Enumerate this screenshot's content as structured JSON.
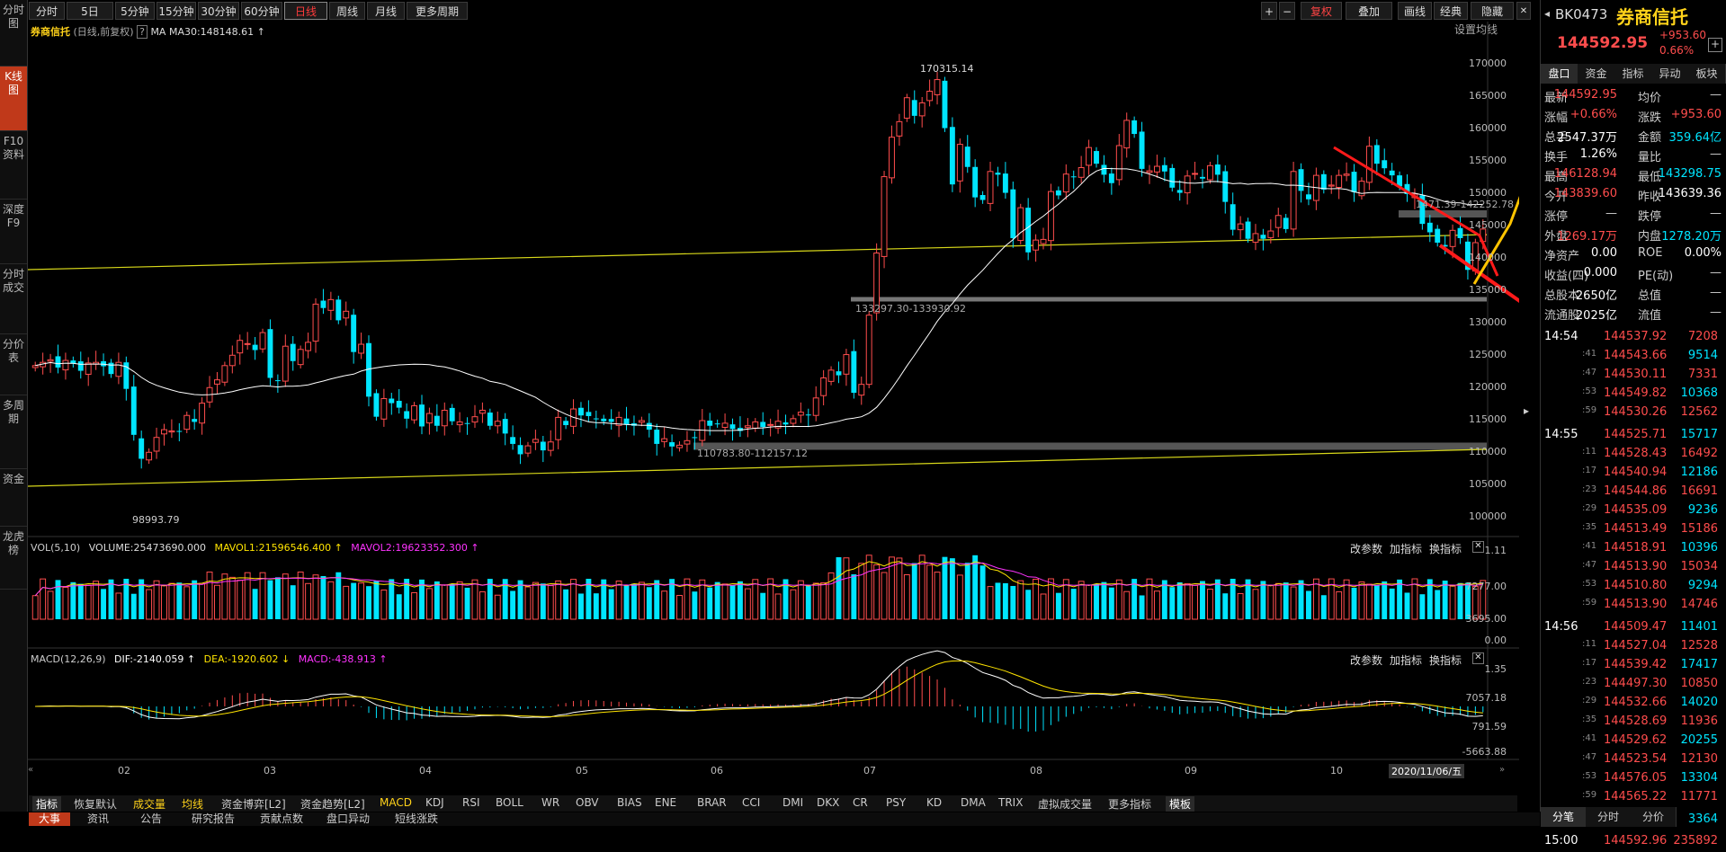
{
  "left_nav": [
    "分时图",
    "K线图",
    "F10资料",
    "深度F9",
    "分时成交",
    "分价表",
    "多周期",
    "资金",
    "龙虎榜"
  ],
  "toolbar": {
    "tabs": [
      "分时",
      "5日",
      "5分钟",
      "15分钟",
      "30分钟",
      "60分钟",
      "日线",
      "周线",
      "月线",
      "更多周期"
    ],
    "active_tab": "日线",
    "right_buttons": [
      "+",
      "−",
      "复权",
      "叠加",
      "画线",
      "经典",
      "隐藏"
    ]
  },
  "main_header": {
    "name": "券商信托",
    "mode": "(日线,前复权)",
    "ma": "MA",
    "ma30": "MA30:148148.61 ↑",
    "setting": "设置均线"
  },
  "price_axis": [
    "170000",
    "165000",
    "160000",
    "155000",
    "150000",
    "145000",
    "140000",
    "135000",
    "130000",
    "125000",
    "120000",
    "115000",
    "110000",
    "105000",
    "100000"
  ],
  "annotations": {
    "high": "170315.14",
    "low": "98993.79",
    "gap1": "133297.30-133930.92",
    "gap2": "110783.80-112157.12",
    "gap3": "1471.39-142252.78"
  },
  "volume": {
    "name": "VOL(5,10)",
    "volume": "VOLUME:25473690.000",
    "mavol1": "MAVOL1:21596546.400 ↑",
    "mavol2": "MAVOL2:19623352.300 ↑",
    "axis": [
      "1.11",
      "7277.00",
      "3695.00",
      "0.00"
    ],
    "actions": [
      "改参数",
      "加指标",
      "换指标"
    ]
  },
  "macd": {
    "name": "MACD(12,26,9)",
    "dif": "DIF:-2140.059 ↑",
    "dea": "DEA:-1920.602 ↓",
    "macd": "MACD:-438.913 ↑",
    "axis": [
      "1.35",
      "7057.18",
      "791.59",
      "-5663.88"
    ],
    "actions": [
      "改参数",
      "加指标",
      "换指标"
    ]
  },
  "date_axis": [
    "02",
    "03",
    "04",
    "05",
    "06",
    "07",
    "08",
    "09",
    "10"
  ],
  "date_label": "2020/11/06/五",
  "indicator_bar": [
    "指标",
    "恢复默认",
    "成交量",
    "均线",
    "资金博弈[L2]",
    "资金趋势[L2]",
    "MACD",
    "KDJ",
    "RSI",
    "BOLL",
    "WR",
    "OBV",
    "BIAS",
    "ENE",
    "BRAR",
    "CCI",
    "DMI",
    "DKX",
    "CR",
    "PSY",
    "KD",
    "DMA",
    "TRIX",
    "虚拟成交量",
    "更多指标",
    "模板"
  ],
  "news_tabs": [
    "大事",
    "资讯",
    "公告",
    "研究报告",
    "贡献点数",
    "盘口异动",
    "短线涨跌"
  ],
  "quote": {
    "code": "BK0473",
    "name": "券商信托",
    "price": "144592.95",
    "change": "+953.60",
    "pct": "0.66%",
    "tabs": [
      "盘口",
      "资金",
      "指标",
      "异动",
      "板块"
    ],
    "rows": [
      [
        "最新",
        "144592.95",
        "均价",
        "—"
      ],
      [
        "涨幅",
        "+0.66%",
        "涨跌",
        "+953.60"
      ],
      [
        "总手",
        "2547.37万",
        "金额",
        "359.64亿"
      ],
      [
        "换手",
        "1.26%",
        "量比",
        "—"
      ],
      [
        "最高",
        "146128.94",
        "最低",
        "143298.75"
      ],
      [
        "今开",
        "143839.60",
        "昨收",
        "143639.36"
      ],
      [
        "涨停",
        "—",
        "跌停",
        "—"
      ],
      [
        "外盘",
        "1269.17万",
        "内盘",
        "1278.20万"
      ],
      [
        "净资产",
        "0.00",
        "ROE",
        "0.00%"
      ],
      [
        "收益(四)",
        "0.000",
        "PE(动)",
        "—"
      ],
      [
        "总股本",
        "2650亿",
        "总值",
        "—"
      ],
      [
        "流通股",
        "2025亿",
        "流值",
        "—"
      ]
    ],
    "bottom_tabs": [
      "分笔",
      "分时",
      "分价"
    ]
  },
  "ticks": [
    [
      "14:54",
      "144537.92",
      "7208"
    ],
    [
      ":41",
      "144543.66",
      "9514"
    ],
    [
      ":47",
      "144530.11",
      "7331"
    ],
    [
      ":53",
      "144549.82",
      "10368"
    ],
    [
      ":59",
      "144530.26",
      "12562"
    ],
    [
      "14:55",
      "144525.71",
      "15717"
    ],
    [
      ":11",
      "144528.43",
      "16492"
    ],
    [
      ":17",
      "144540.94",
      "12186"
    ],
    [
      ":23",
      "144544.86",
      "16691"
    ],
    [
      ":29",
      "144535.09",
      "9236"
    ],
    [
      ":35",
      "144513.49",
      "15186"
    ],
    [
      ":41",
      "144518.91",
      "10396"
    ],
    [
      ":47",
      "144513.90",
      "15034"
    ],
    [
      ":53",
      "144510.80",
      "9294"
    ],
    [
      ":59",
      "144513.90",
      "14746"
    ],
    [
      "14:56",
      "144509.47",
      "11401"
    ],
    [
      ":11",
      "144527.04",
      "12528"
    ],
    [
      ":17",
      "144539.42",
      "17417"
    ],
    [
      ":23",
      "144497.30",
      "10850"
    ],
    [
      ":29",
      "144532.66",
      "14020"
    ],
    [
      ":35",
      "144528.69",
      "11936"
    ],
    [
      ":41",
      "144529.62",
      "20255"
    ],
    [
      ":47",
      "144523.54",
      "12130"
    ],
    [
      ":53",
      "144576.05",
      "13304"
    ],
    [
      ":59",
      "144565.22",
      "11771"
    ],
    [
      "14:57",
      "144565.52",
      "3364"
    ],
    [
      "15:00",
      "144592.96",
      "235892"
    ]
  ],
  "colors": {
    "up": "#ff4d4d",
    "down": "#00e5ff",
    "ma": "#ffffff",
    "trend_line": "#d8d81a",
    "arrow_red": "#ff1a1a",
    "arrow_yellow": "#ffc400",
    "vol_ma1": "#ffe400",
    "vol_ma2": "#ff33ff"
  },
  "chart_data": {
    "type": "candlestick",
    "price_ylim": [
      98000,
      172000
    ],
    "closes": [
      123500,
      124000,
      124400,
      123200,
      124300,
      123800,
      122700,
      123900,
      124000,
      123400,
      122200,
      124000,
      119900,
      112800,
      109100,
      110100,
      112400,
      113600,
      113400,
      113300,
      115800,
      114800,
      117700,
      120100,
      121300,
      123500,
      125100,
      127400,
      126900,
      125900,
      128600,
      121600,
      121100,
      126500,
      124200,
      126000,
      127100,
      133000,
      132400,
      133700,
      130500,
      131900,
      125600,
      126800,
      118700,
      115600,
      118400,
      117700,
      117000,
      115300,
      117300,
      114100,
      116100,
      114200,
      116600,
      114900,
      114800,
      114600,
      115600,
      116600,
      114200,
      114900,
      113000,
      111400,
      109800,
      111100,
      112100,
      110400,
      111700,
      115500,
      114300,
      116800,
      115800,
      115700,
      115300,
      114900,
      114800,
      115500,
      114400,
      114200,
      115000,
      113600,
      111400,
      112200,
      111000,
      111200,
      111900,
      112300,
      115000,
      114200,
      114500,
      114600,
      113700,
      113400,
      114200,
      114800,
      114000,
      114400,
      114900,
      114400,
      115300,
      116300,
      115800,
      118500,
      121600,
      122800,
      122000,
      125200,
      119300,
      120600,
      131300,
      140900,
      152700,
      158800,
      161200,
      164900,
      162100,
      164100,
      165900,
      167700,
      160200,
      151500,
      157700,
      154200,
      149500,
      149100,
      153500,
      153000,
      150200,
      143200,
      147900,
      141000,
      142900,
      143000,
      150400,
      149800,
      153100,
      152600,
      154100,
      157200,
      154700,
      153000,
      151700,
      157500,
      161400,
      159300,
      153900,
      153600,
      154300,
      153500,
      151000,
      150200,
      152800,
      153200,
      152400,
      154400,
      153000,
      148800,
      144500,
      145400,
      143100,
      143900,
      143100,
      144300,
      146700,
      144600,
      153500,
      150500,
      149200,
      152900,
      150700,
      151400,
      152900,
      153100,
      150300,
      152000,
      157400,
      154700,
      154000,
      152900,
      151200,
      150000,
      150000,
      145400,
      144100,
      142500,
      141900,
      144400,
      143200,
      138300,
      142500,
      144600
    ]
  }
}
